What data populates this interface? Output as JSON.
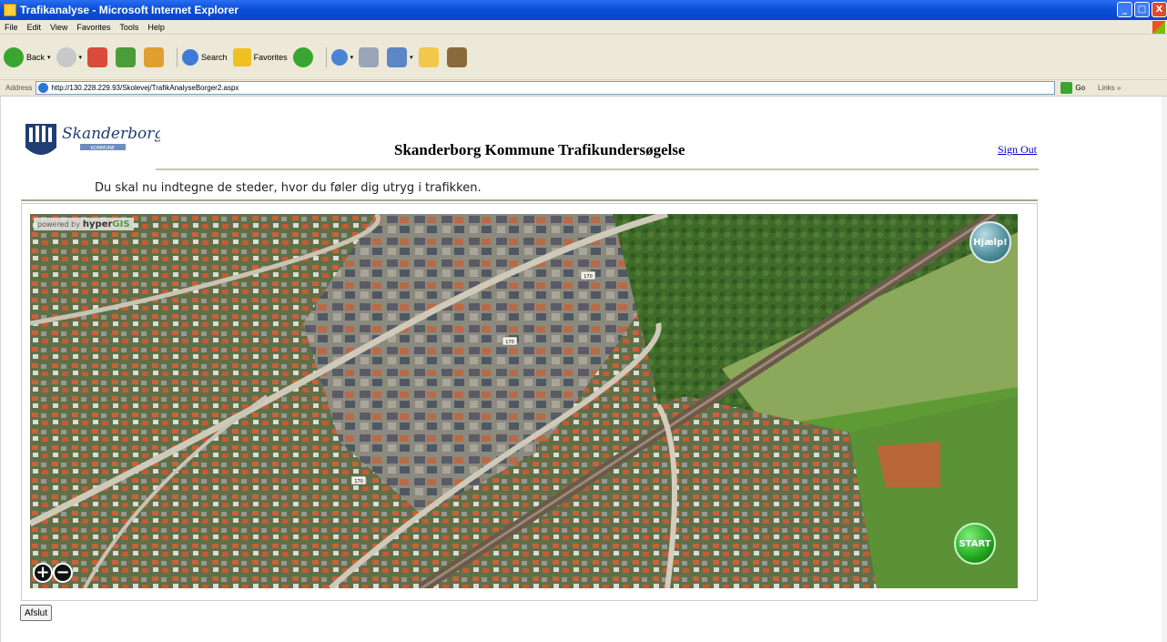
{
  "window": {
    "title": "Trafikanalyse - Microsoft Internet Explorer",
    "controls": [
      "_",
      "□",
      "X"
    ]
  },
  "menu": [
    "File",
    "Edit",
    "View",
    "Favorites",
    "Tools",
    "Help"
  ],
  "toolbar": {
    "back_label": "Back",
    "search_label": "Search",
    "favorites_label": "Favorites"
  },
  "address": {
    "label": "Address",
    "url": "http://130.228.229.93/Skolevej/TrafikAnalyseBorger2.aspx",
    "go_label": "Go",
    "links_label": "Links"
  },
  "page": {
    "logo_text": "Skanderborg",
    "logo_subtext": "KOMMUNE",
    "heading": "Skanderborg Kommune Trafikundersøgelse",
    "signout": "Sign Out",
    "instruction": "Du skal nu indtegne de steder, hvor du føler dig utryg i trafikken.",
    "map": {
      "powered_by": "powered by",
      "brand_a": "hyper",
      "brand_b": "GIS",
      "help_label": "Hjælp!",
      "start_label": "START",
      "zoom_in": "+",
      "zoom_out": "−",
      "road_labels": [
        "170",
        "170",
        "170"
      ]
    },
    "exit_button": "Afslut"
  },
  "colors": {
    "titlebar": "#0a4fd8",
    "chrome": "#ece9d8",
    "link": "#0000cc",
    "help_button": "#4c8d99",
    "start_button": "#22a51d"
  }
}
